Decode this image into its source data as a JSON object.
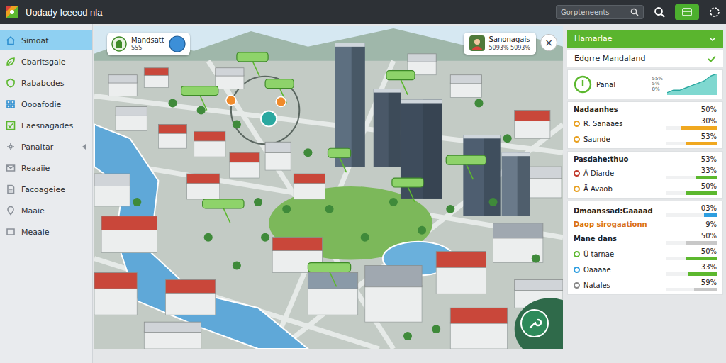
{
  "window": {
    "title": "Uodady Iceeod nla"
  },
  "search": {
    "placeholder": "Gorpteneents"
  },
  "sidebar": {
    "items": [
      {
        "label": "Simoat",
        "selected": true,
        "has_submenu": false
      },
      {
        "label": "Cbaritsgaie",
        "selected": false,
        "has_submenu": false
      },
      {
        "label": "Rababcdes",
        "selected": false,
        "has_submenu": false
      },
      {
        "label": "Oooafodie",
        "selected": false,
        "has_submenu": false
      },
      {
        "label": "Eaesnagades",
        "selected": false,
        "has_submenu": false
      },
      {
        "label": "Panaitar",
        "selected": false,
        "has_submenu": true
      },
      {
        "label": "Reaaiie",
        "selected": false,
        "has_submenu": false
      },
      {
        "label": "Facoageiee",
        "selected": false,
        "has_submenu": false
      },
      {
        "label": "Maaie",
        "selected": false,
        "has_submenu": false
      },
      {
        "label": "Meaaie",
        "selected": false,
        "has_submenu": false
      }
    ]
  },
  "map": {
    "info_card": {
      "title": "Mandsatt",
      "subtitle": "SSS"
    },
    "user_card": {
      "name": "Sanonagais",
      "stats": "5093% 5093%"
    },
    "close": "×"
  },
  "panel": {
    "header": "Hamarlae",
    "subheader": "Edgrre Mandaland",
    "status": {
      "label": "Panal",
      "ticks": [
        "55%",
        "5%",
        "0%"
      ],
      "series": [
        1,
        2,
        2,
        3,
        4,
        5,
        6,
        8,
        9
      ]
    },
    "groups": [
      {
        "rows": [
          {
            "kind": "title",
            "label": "Nadaanhes",
            "value": "50%",
            "color": "#222222"
          },
          {
            "kind": "metric",
            "label": "R. Sanaaes",
            "value": "30%",
            "dot_color": "#e8a020",
            "level": 0.7,
            "color": "#f0a820"
          },
          {
            "kind": "metric",
            "label": "Saunde",
            "value": "53%",
            "dot_color": "#e8a020",
            "level": 0.6,
            "color": "#f0a820"
          }
        ]
      },
      {
        "rows": [
          {
            "kind": "title",
            "label": "Pasdahe:thuo",
            "value": "53%",
            "color": "#222222"
          },
          {
            "kind": "metric",
            "label": "Ä Diarde",
            "value": "33%",
            "dot_color": "#c0392b",
            "level": 0.4,
            "color": "#5cb82e"
          },
          {
            "kind": "metric",
            "label": "Ä Avaob",
            "value": "50%",
            "dot_color": "#e8a020",
            "level": 0.6,
            "color": "#5cb82e"
          }
        ]
      },
      {
        "rows": [
          {
            "kind": "title-bar",
            "label": "Dmoanssad:Gaaaad",
            "value": "03%",
            "level": 0.25,
            "color": "#2e9ee0"
          },
          {
            "kind": "title",
            "label": "Daop sirogaationn",
            "value": "9%",
            "color": "#d9700f"
          },
          {
            "kind": "title-bar",
            "label": "Mane dans",
            "value": "50%",
            "level": 0.6,
            "color": "#c8c8c8"
          },
          {
            "kind": "metric",
            "label": "Ü tarnae",
            "value": "50%",
            "dot_color": "#5cb82e",
            "level": 0.6,
            "color": "#5cb82e"
          },
          {
            "kind": "metric",
            "label": "Oaaaae",
            "value": "33%",
            "dot_color": "#2e9ee0",
            "level": 0.55,
            "color": "#5cb82e"
          },
          {
            "kind": "metric",
            "label": "Natales",
            "value": "59%",
            "dot_color": "#888888",
            "level": 0.45,
            "color": "#c8c8c8"
          }
        ]
      }
    ]
  }
}
